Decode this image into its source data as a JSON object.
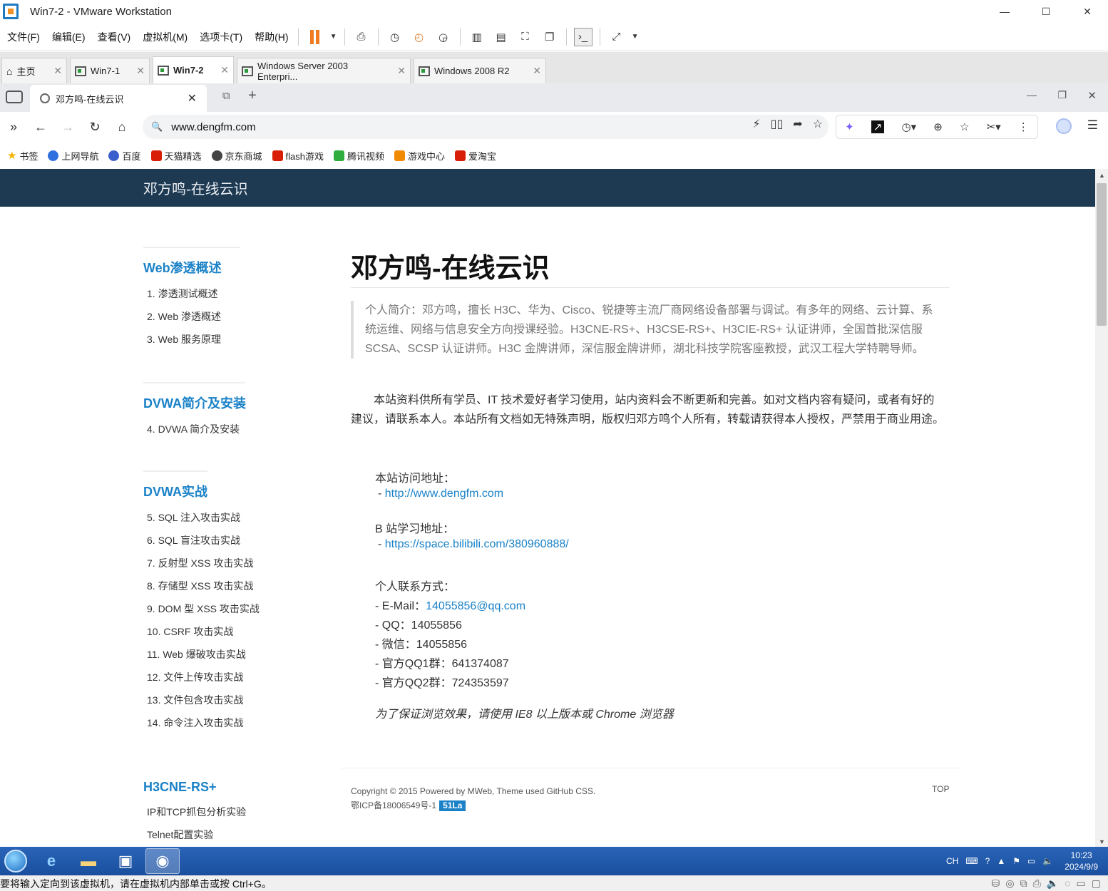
{
  "window": {
    "title": "Win7-2 - VMware Workstation"
  },
  "vm_menu": [
    "文件(F)",
    "编辑(E)",
    "查看(V)",
    "虚拟机(M)",
    "选项卡(T)",
    "帮助(H)"
  ],
  "vm_tabs": [
    {
      "label": "主页"
    },
    {
      "label": "Win7-1"
    },
    {
      "label": "Win7-2"
    },
    {
      "label": "Windows Server 2003 Enterpri..."
    },
    {
      "label": "Windows 2008 R2"
    }
  ],
  "browser": {
    "tab_title": "邓方鸣-在线云识",
    "url": "www.dengfm.com"
  },
  "bookmarks": [
    {
      "label": "书签",
      "color": "#f5b400"
    },
    {
      "label": "上网导航",
      "color": "#2f6fe0"
    },
    {
      "label": "百度",
      "color": "#3a5fcd"
    },
    {
      "label": "天猫精选",
      "color": "#d81e06"
    },
    {
      "label": "京东商城",
      "color": "#444444"
    },
    {
      "label": "flash游戏",
      "color": "#d81e06"
    },
    {
      "label": "腾讯视频",
      "color": "#2fae3f"
    },
    {
      "label": "游戏中心",
      "color": "#f08a00"
    },
    {
      "label": "爱淘宝",
      "color": "#d81e06"
    }
  ],
  "site": {
    "header_title": "邓方鸣-在线云识",
    "sidebar": [
      {
        "title": "Web渗透概述",
        "items": [
          "1. 渗透测试概述",
          "2. Web 渗透概述",
          "3. Web 服务原理"
        ]
      },
      {
        "title": "DVWA简介及安装",
        "items": [
          "4. DVWA 简介及安装"
        ]
      },
      {
        "title": "DVWA实战",
        "items": [
          "5. SQL 注入攻击实战",
          "6. SQL 盲注攻击实战",
          "7. 反射型 XSS 攻击实战",
          "8. 存储型 XSS 攻击实战",
          "9. DOM 型 XSS 攻击实战",
          "10. CSRF 攻击实战",
          "11. Web 爆破攻击实战",
          "12. 文件上传攻击实战",
          "13. 文件包含攻击实战",
          "14. 命令注入攻击实战"
        ]
      },
      {
        "title": "H3CNE-RS+",
        "items": [
          "IP和TCP抓包分析实验",
          "Telnet配置实验"
        ]
      }
    ],
    "main": {
      "title": "邓方鸣-在线云识",
      "quote": "个人简介：邓方鸣，擅长 H3C、华为、Cisco、锐捷等主流厂商网络设备部署与调试。有多年的网络、云计算、系统运维、网络与信息安全方向授课经验。H3CNE-RS+、H3CSE-RS+、H3CIE-RS+ 认证讲师，全国首批深信服 SCSA、SCSP 认证讲师。H3C 金牌讲师，深信服金牌讲师，湖北科技学院客座教授，武汉工程大学特聘导师。",
      "para": "本站资料供所有学员、IT 技术爱好者学习使用，站内资料会不断更新和完善。如对文档内容有疑问，或者有好的建议，请联系本人。本站所有文档如无特殊声明，版权归邓方鸣个人所有，转载请获得本人授权，严禁用于商业用途。",
      "visit_label": "本站访问地址：",
      "visit_link": "http://www.dengfm.com",
      "bili_label": "B 站学习地址：",
      "bili_link": "https://space.bilibili.com/380960888/",
      "contact_label": "个人联系方式：",
      "email_label": "- E-Mail：",
      "email": "14055856@qq.com",
      "qq": "- QQ：14055856",
      "wechat": "- 微信：14055856",
      "group1": "- 官方QQ1群：641374087",
      "group2": "- 官方QQ2群：724353597",
      "browser_note": "为了保证浏览效果，请使用 IE8 以上版本或 Chrome 浏览器"
    },
    "footer": {
      "copyright": "Copyright © 2015 Powered by MWeb,  Theme used GitHub CSS.",
      "icp": "鄂ICP备18006549号-1",
      "badge": "51La",
      "top": "TOP"
    }
  },
  "taskbar": {
    "ime": "CH",
    "time": "10:23",
    "date": "2024/9/9"
  },
  "status": {
    "text": "要将输入定向到该虚拟机，请在虚拟机内部单击或按 Ctrl+G。"
  }
}
